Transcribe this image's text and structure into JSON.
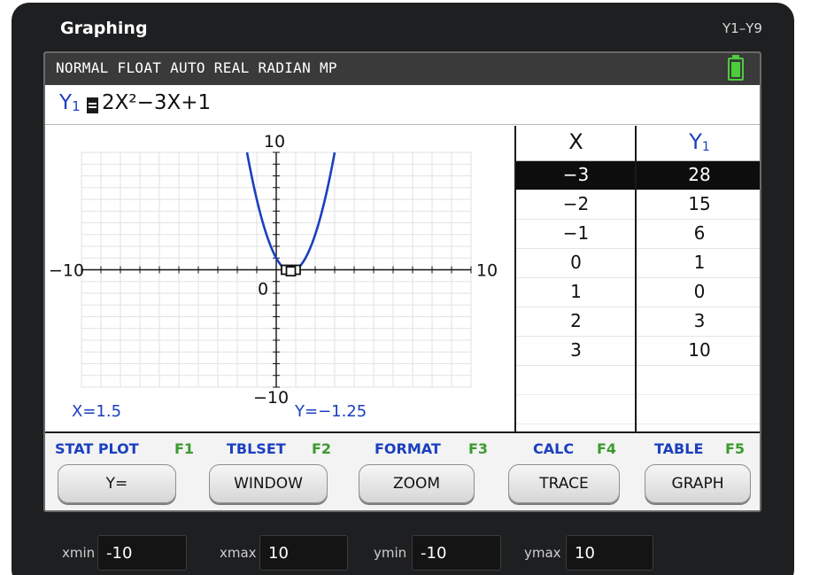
{
  "app": {
    "title": "Graphing",
    "function_range": "Y1–Y9"
  },
  "status_bar": {
    "text": "NORMAL FLOAT AUTO REAL RADIAN MP",
    "battery_color": "#4ccd3c"
  },
  "equation": {
    "label_var": "Y",
    "label_sub": "1",
    "expression": "2X²−3X+1",
    "curve_color": "#1a3fbf"
  },
  "graph": {
    "y_max_label": "10",
    "y_min_label": "−10",
    "x_min_label": "−10",
    "x_max_label": "10",
    "origin_label": "0",
    "trace_x": "X=1.5",
    "trace_y": "Y=−1.25",
    "xmin": -10,
    "xmax": 10,
    "ymin": -10,
    "ymax": 10,
    "grid": true,
    "marked_points": [
      [
        0.5,
        0
      ],
      [
        1,
        0
      ],
      [
        0.75,
        -0.125
      ]
    ]
  },
  "table": {
    "header_x": "X",
    "header_y_var": "Y",
    "header_y_sub": "1",
    "selected_index": 0,
    "rows": [
      {
        "x": "−3",
        "y": "28"
      },
      {
        "x": "−2",
        "y": "15"
      },
      {
        "x": "−1",
        "y": "6"
      },
      {
        "x": "0",
        "y": "1"
      },
      {
        "x": "1",
        "y": "0"
      },
      {
        "x": "2",
        "y": "3"
      },
      {
        "x": "3",
        "y": "10"
      }
    ],
    "empty_rows": 3
  },
  "softkeys": [
    {
      "label": "STAT PLOT",
      "fn": "F1",
      "button": "Y="
    },
    {
      "label": "TBLSET",
      "fn": "F2",
      "button": "WINDOW"
    },
    {
      "label": "FORMAT",
      "fn": "F3",
      "button": "ZOOM"
    },
    {
      "label": "CALC",
      "fn": "F4",
      "button": "TRACE"
    },
    {
      "label": "TABLE",
      "fn": "F5",
      "button": "GRAPH"
    }
  ],
  "window_vars": {
    "xmin_label": "xmin",
    "xmin_value": "-10",
    "xmax_label": "xmax",
    "xmax_value": "10",
    "ymin_label": "ymin",
    "ymin_value": "-10",
    "ymax_label": "ymax",
    "ymax_value": "10"
  }
}
